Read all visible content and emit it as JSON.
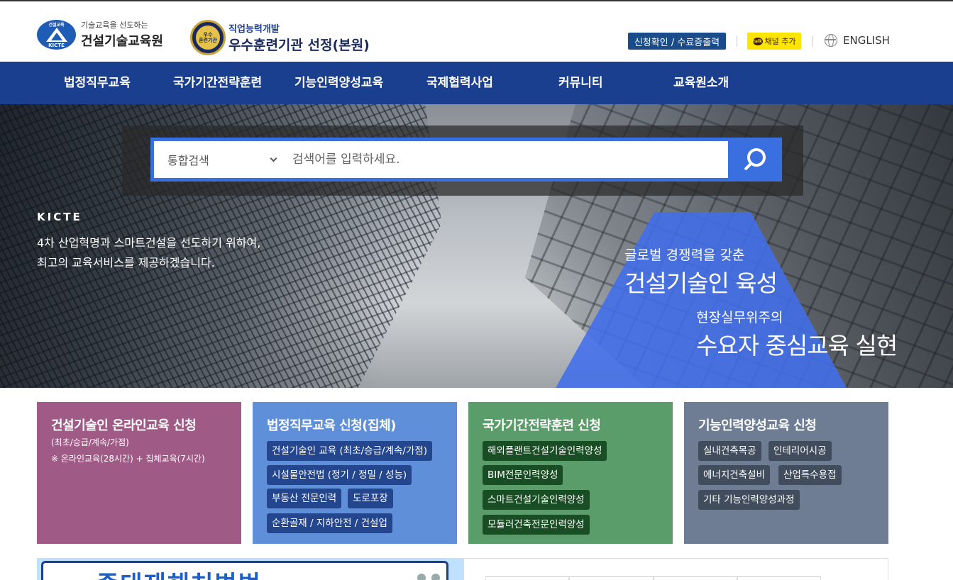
{
  "header": {
    "logo1": {
      "emblem_top": "건설교육",
      "emblem_bottom": "KICTE",
      "sub": "기술교육을 선도하는",
      "main": "건설기술교육원"
    },
    "logo2": {
      "seal_line1": "우수",
      "seal_line2": "훈련기관",
      "sub": "직업능력개발",
      "main": "우수훈련기관 선정(본원)"
    },
    "cert_button": "신청확인 / 수료증출력",
    "kakao_button": "채널 추가",
    "kakao_icon_text": "talk",
    "language": "ENGLISH"
  },
  "nav": [
    "법정직무교육",
    "국가기간전략훈련",
    "기능인력양성교육",
    "국제협력사업",
    "커뮤니티",
    "교육원소개"
  ],
  "search": {
    "select_value": "통합검색",
    "placeholder": "검색어를 입력하세요."
  },
  "hero": {
    "brand": "KICTE",
    "slogan_line1": "4차 산업혁명과 스마트건설을 선도하기 위하여,",
    "slogan_line2": "최고의 교육서비스를 제공하겠습니다.",
    "right_line1": "글로벌 경쟁력을 갖춘",
    "right_line2": "건설기술인 육성",
    "right_line3": "현장실무위주의",
    "right_line4": "수요자 중심교육 실현"
  },
  "cards": [
    {
      "title": "건설기술인 온라인교육 신청",
      "small1": "(최초/승급/계속/가점)",
      "small2": "※ 온라인교육(28시간) + 집체교육(7시간)",
      "color": "#a05a86"
    },
    {
      "title": "법정직무교육 신청(집체)",
      "tags": [
        "건설기술인 교육 (최초/승급/계속/가점)",
        "시설물안전법 (정기 / 정밀 / 성능)",
        "부동산 전문인력",
        "도로포장",
        "순환골재 / 지하안전 / 건설업"
      ],
      "color": "#5f8fd8"
    },
    {
      "title": "국가기간전략훈련 신청",
      "tags": [
        "해외플랜트건설기술인력양성",
        "BIM전문인력양성",
        "스마트건설기술인력양성",
        "모듈러건축전문인력양성"
      ],
      "color": "#5b9d6a"
    },
    {
      "title": "기능인력양성교육 신청",
      "tags": [
        "실내건축목공",
        "인테리어시공",
        "에너지건축설비",
        "산업특수용접",
        "기타 기능인력양성과정"
      ],
      "color": "#6e7d93"
    }
  ],
  "bottom": {
    "banner_text": "중대재해처벌법"
  },
  "colors": {
    "nav": "#1b3f8f",
    "search_accent": "#3a6fe0",
    "kakao": "#fee500",
    "cert_button": "#1a4c8a"
  }
}
